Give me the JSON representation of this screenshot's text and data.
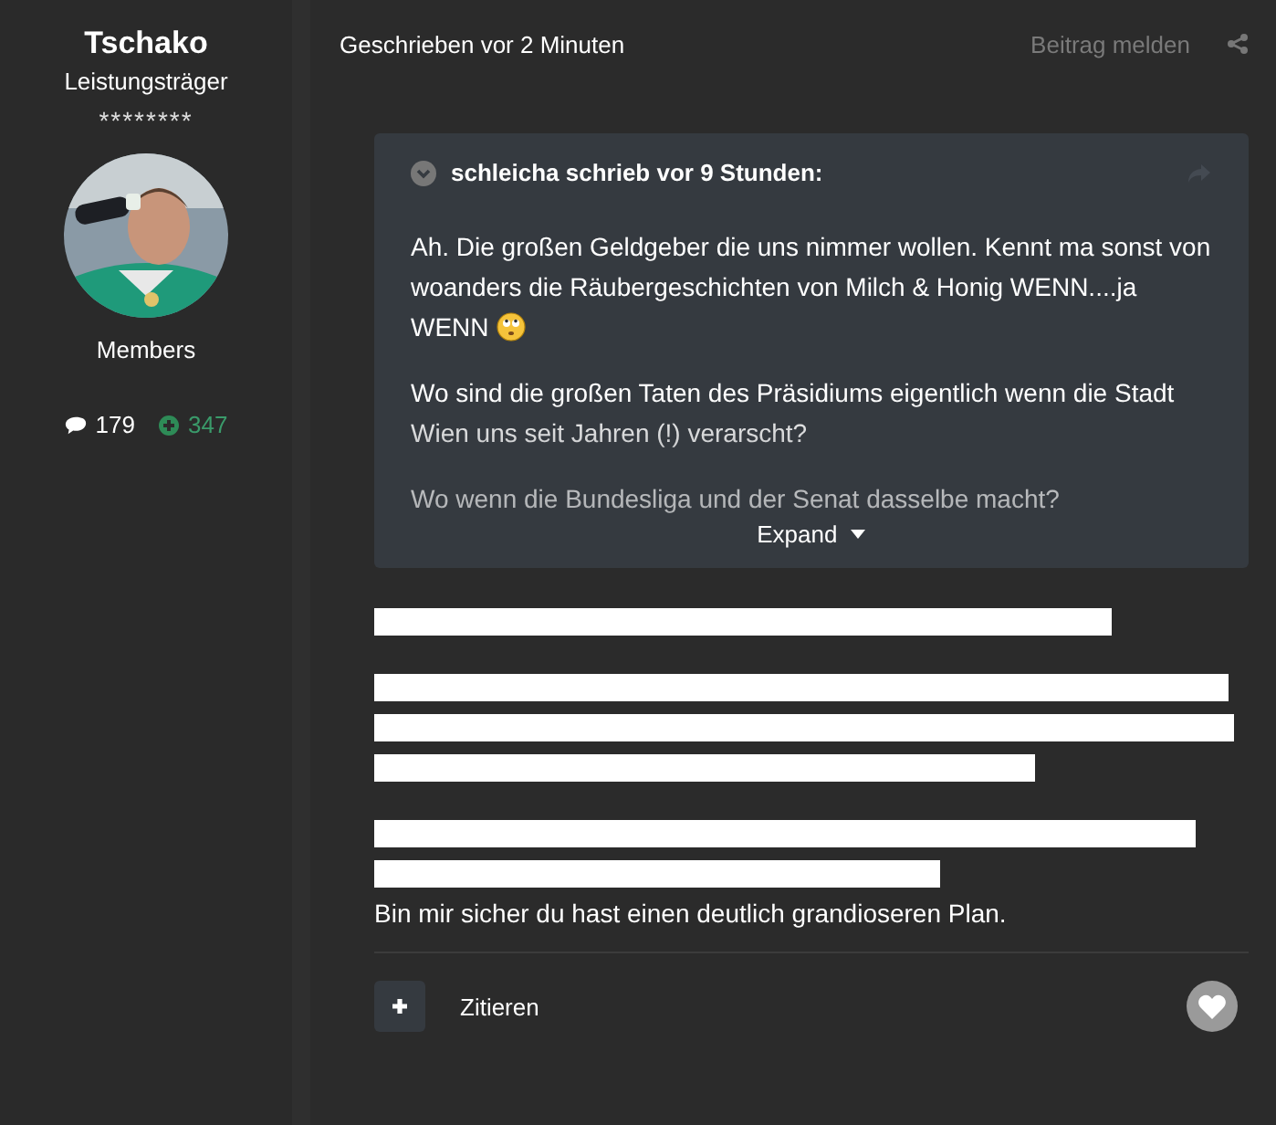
{
  "author": {
    "name": "Tschako",
    "rank": "Leistungsträger",
    "stars": "********",
    "group": "Members",
    "posts": "179",
    "reputation": "347"
  },
  "post": {
    "timestamp": "Geschrieben vor 2 Minuten",
    "report": "Beitrag melden",
    "quote": {
      "header": "schleicha schrieb vor 9 Stunden:",
      "paragraphs": [
        {
          "text": "Ah. Die großen Geldgeber die uns nimmer wollen. Kennt ma sonst von woanders die Räubergeschichten von Milch & Honig WENN....ja WENN",
          "emoji": true
        },
        {
          "text": "Wo sind die großen Taten des Präsidiums eigentlich wenn die Stadt Wien uns seit Jahren (!) verarscht?",
          "emoji": false
        },
        {
          "text": "Wo wenn die Bundesliga und der Senat dasselbe macht?",
          "emoji": false
        }
      ],
      "expand": "Expand"
    },
    "body": [
      {
        "kind": "redacted"
      },
      {
        "kind": "redacted"
      },
      {
        "kind": "redacted",
        "text": "Bin mir sicher du hast einen deutlich grandioseren Plan."
      }
    ],
    "quote_button": "Zitieren"
  }
}
